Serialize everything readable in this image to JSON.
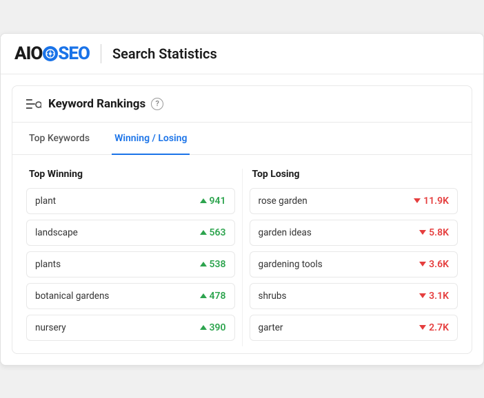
{
  "header": {
    "logo": {
      "ai": "AI",
      "o": "O",
      "seo": "SEO"
    },
    "title": "Search Statistics"
  },
  "card": {
    "title": "Keyword Rankings",
    "help_label": "?",
    "tabs": [
      {
        "id": "top-keywords",
        "label": "Top Keywords",
        "active": false
      },
      {
        "id": "winning-losing",
        "label": "Winning / Losing",
        "active": true
      }
    ],
    "winning": {
      "header": "Top Winning",
      "items": [
        {
          "keyword": "plant",
          "value": "941"
        },
        {
          "keyword": "landscape",
          "value": "563"
        },
        {
          "keyword": "plants",
          "value": "538"
        },
        {
          "keyword": "botanical gardens",
          "value": "478"
        },
        {
          "keyword": "nursery",
          "value": "390"
        }
      ]
    },
    "losing": {
      "header": "Top Losing",
      "items": [
        {
          "keyword": "rose garden",
          "value": "11.9K"
        },
        {
          "keyword": "garden ideas",
          "value": "5.8K"
        },
        {
          "keyword": "gardening tools",
          "value": "3.6K"
        },
        {
          "keyword": "shrubs",
          "value": "3.1K"
        },
        {
          "keyword": "garter",
          "value": "2.7K"
        }
      ]
    }
  },
  "colors": {
    "winning": "#2da44e",
    "losing": "#e53e3e",
    "accent": "#1a73e8"
  }
}
